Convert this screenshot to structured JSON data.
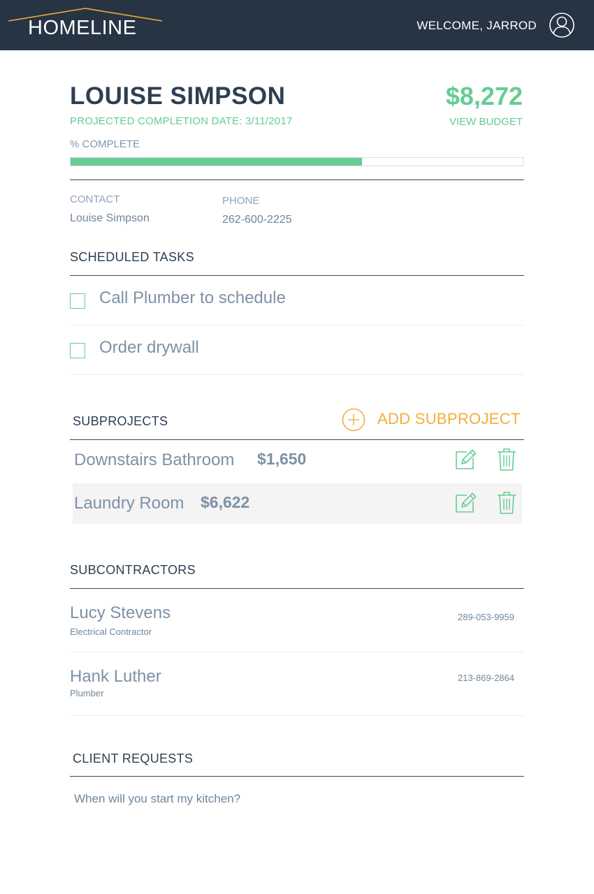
{
  "header": {
    "logo_text": "HOMELINE",
    "welcome_text": "WELCOME, JARROD",
    "user_icon": "user-profile-icon",
    "background_color": "#263444",
    "logo_roof_color": "#f5ad3b"
  },
  "project": {
    "client_name": "LOUISE SIMPSON",
    "completion_date_label": "PROJECTED COMPLETION DATE: 3/11/2017",
    "budget_amount": "$8,272",
    "view_budget_label": "VIEW BUDGET",
    "percent_complete_label": "% COMPLETE",
    "percent_complete": 0.645,
    "accent_color": "#66cc94"
  },
  "contact": {
    "contact_label": "CONTACT",
    "contact_value": "Louise Simpson",
    "phone_label": "PHONE",
    "phone_value": "262-600-2225"
  },
  "tasks": {
    "title": "SCHEDULED TASKS",
    "items": [
      {
        "label": "Call Plumber to schedule",
        "checked": false
      },
      {
        "label": "Order drywall",
        "checked": false
      }
    ]
  },
  "subprojects": {
    "title": "SUBPROJECTS",
    "add_label": "ADD SUBPROJECT",
    "add_color": "#f5ad3b",
    "items": [
      {
        "name": "Downstairs Bathroom",
        "amount": "$1,650",
        "edit_icon": "edit-icon",
        "delete_icon": "trash-icon"
      },
      {
        "name": "Laundry Room",
        "amount": "$6,622",
        "edit_icon": "edit-icon",
        "delete_icon": "trash-icon"
      }
    ]
  },
  "subcontractors": {
    "title": "SUBCONTRACTORS",
    "items": [
      {
        "name": "Lucy Stevens",
        "role": "Electrical Contractor",
        "phone": "289-053-9959"
      },
      {
        "name": "Hank Luther",
        "role": "Plumber",
        "phone": "213-869-2864"
      }
    ]
  },
  "client_requests": {
    "title": "CLIENT REQUESTS",
    "items": [
      {
        "text": "When will you start my kitchen?"
      }
    ]
  }
}
